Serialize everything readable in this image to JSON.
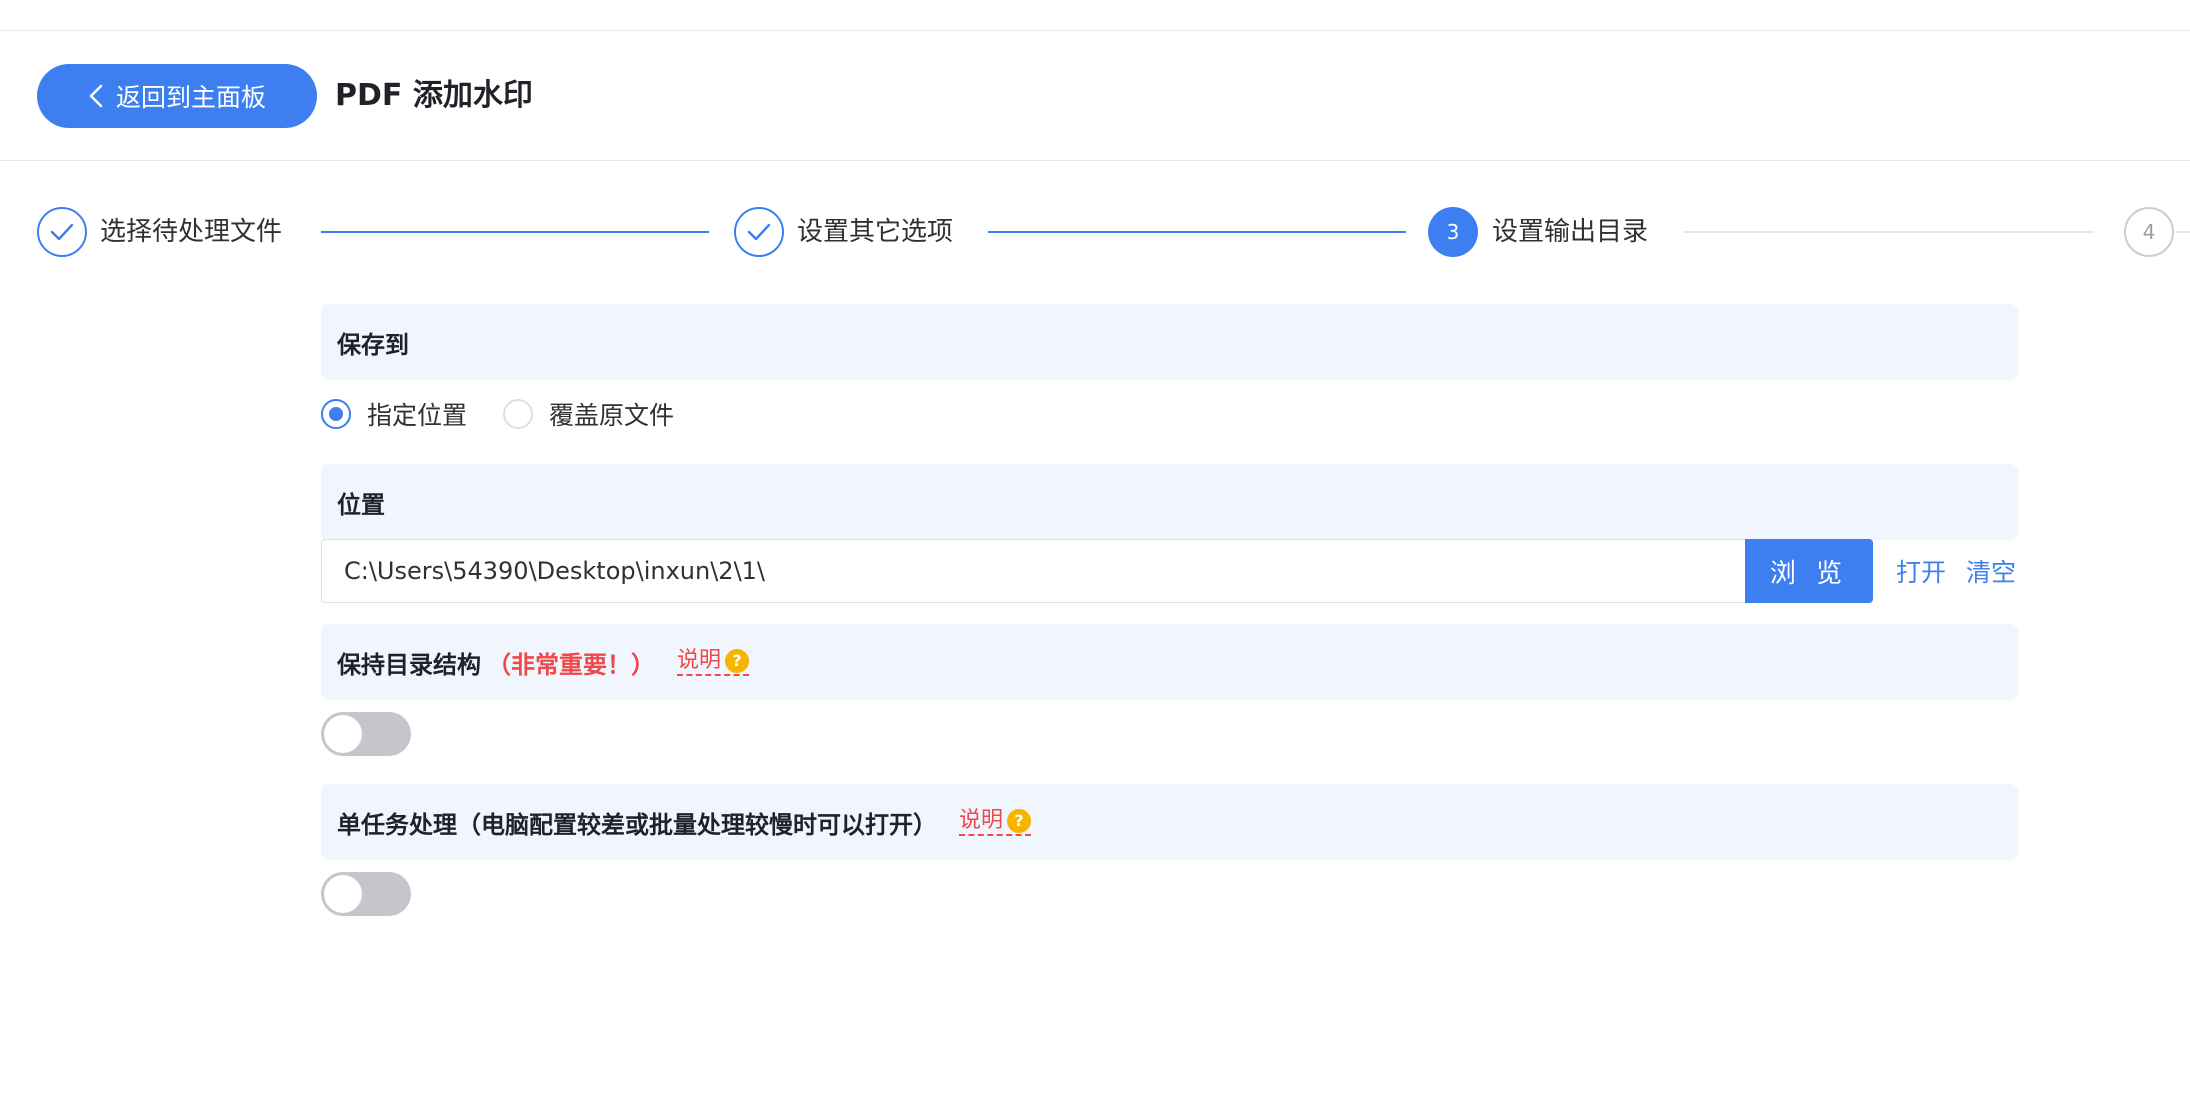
{
  "header": {
    "back_label": "返回到主面板",
    "title": "PDF 添加水印"
  },
  "steps": [
    {
      "label": "选择待处理文件",
      "status": "done"
    },
    {
      "label": "设置其它选项",
      "status": "done"
    },
    {
      "number": "3",
      "label": "设置输出目录",
      "status": "active"
    },
    {
      "number": "4",
      "label": "",
      "status": "todo"
    }
  ],
  "save_to": {
    "heading": "保存到",
    "options": [
      {
        "label": "指定位置",
        "checked": true
      },
      {
        "label": "覆盖原文件",
        "checked": false
      }
    ]
  },
  "location": {
    "heading": "位置",
    "path_value": "C:\\Users\\54390\\Desktop\\inxun\\2\\1\\",
    "browse_label": "浏 览",
    "open_label": "打开",
    "clear_label": "清空"
  },
  "keep_structure": {
    "heading": "保持目录结构",
    "emphasis": "（非常重要！）",
    "help_label": "说明",
    "enabled": false
  },
  "single_task": {
    "heading": "单任务处理（电脑配置较差或批量处理较慢时可以打开）",
    "help_label": "说明",
    "enabled": false
  },
  "colors": {
    "primary": "#3d7ff0",
    "section_bg": "#f1f6fe",
    "warning_red": "#f04848",
    "help_icon": "#f5b400"
  }
}
